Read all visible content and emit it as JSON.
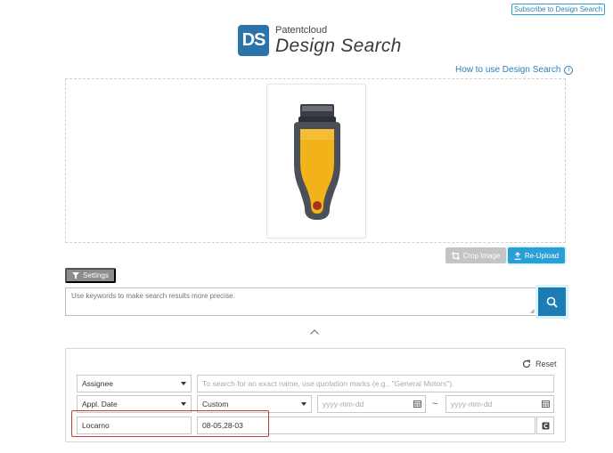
{
  "header": {
    "subscribe_label": "Subscribe to Design Search",
    "logo_mark": "DS",
    "logo_small": "Patentcloud",
    "logo_big": "Design Search",
    "howto_label": "How to use Design Search",
    "howto_icon": "i"
  },
  "upload": {
    "crop_label": "Crop Image",
    "reupload_label": "Re-Upload"
  },
  "search": {
    "settings_label": "Settings",
    "keyword_placeholder": "Use keywords to make search results more precise."
  },
  "filters": {
    "reset_label": "Reset",
    "rows": [
      {
        "field": "Assignee",
        "value_placeholder": "To search for an exact name, use quotation marks (e.g., \"General Motors\")."
      },
      {
        "field": "Appl. Date",
        "range_type": "Custom",
        "from_placeholder": "yyyy-mm-dd",
        "separator": "~",
        "to_placeholder": "yyyy-mm-dd"
      },
      {
        "field": "Locarno",
        "value": "08-05,28-03"
      }
    ]
  },
  "colors": {
    "accent": "#2a9fd6",
    "search_button": "#1e7cb4",
    "logo": "#2b73a8",
    "highlight": "#b9413a"
  }
}
